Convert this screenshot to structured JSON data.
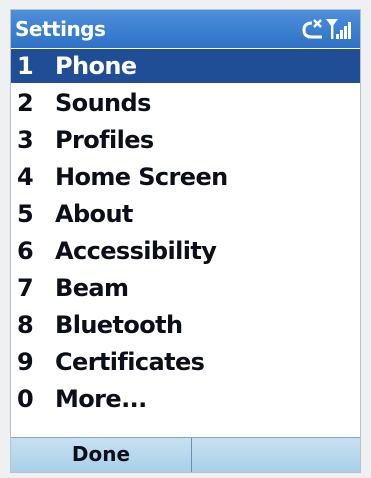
{
  "titlebar": {
    "title": "Settings",
    "icons": [
      "connection-icon",
      "signal-strength-icon"
    ]
  },
  "menu": {
    "items": [
      {
        "number": "1",
        "label": "Phone",
        "selected": true
      },
      {
        "number": "2",
        "label": "Sounds",
        "selected": false
      },
      {
        "number": "3",
        "label": "Profiles",
        "selected": false
      },
      {
        "number": "4",
        "label": "Home Screen",
        "selected": false
      },
      {
        "number": "5",
        "label": "About",
        "selected": false
      },
      {
        "number": "6",
        "label": "Accessibility",
        "selected": false
      },
      {
        "number": "7",
        "label": "Beam",
        "selected": false
      },
      {
        "number": "8",
        "label": "Bluetooth",
        "selected": false
      },
      {
        "number": "9",
        "label": "Certificates",
        "selected": false
      },
      {
        "number": "0",
        "label": "More...",
        "selected": false
      }
    ]
  },
  "softkeys": {
    "left": "Done",
    "right": ""
  },
  "colors": {
    "titlebar": "#3b7fcf",
    "selection": "#1f4e97",
    "softkey_bar": "#b9d8ee",
    "text": "#0b0f1a"
  }
}
